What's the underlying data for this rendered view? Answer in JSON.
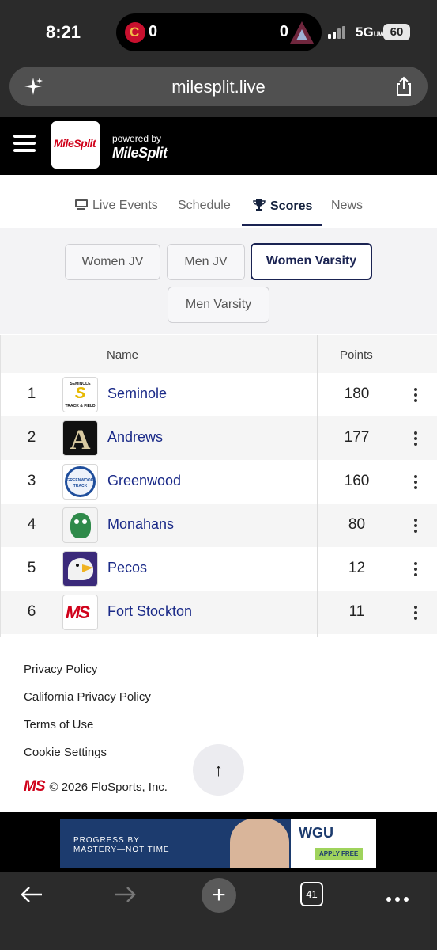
{
  "status_bar": {
    "time": "8:21",
    "score_left": "0",
    "score_right": "0",
    "network": "5G",
    "network_suffix": "UW",
    "battery": "60"
  },
  "browser": {
    "url": "milesplit.live",
    "tabs_count": "41"
  },
  "header": {
    "logo_text": "MileSplit",
    "powered_by": "powered by",
    "powered_logo": "MileSplit"
  },
  "nav_tabs": [
    {
      "label": "Live Events",
      "icon": "live-events-icon"
    },
    {
      "label": "Schedule"
    },
    {
      "label": "Scores",
      "icon": "trophy-icon",
      "active": true
    },
    {
      "label": "News"
    }
  ],
  "filters": [
    {
      "label": "Women JV"
    },
    {
      "label": "Men JV"
    },
    {
      "label": "Women Varsity",
      "active": true
    },
    {
      "label": "Men Varsity"
    }
  ],
  "table": {
    "col_name": "Name",
    "col_points": "Points",
    "rows": [
      {
        "rank": "1",
        "name": "Seminole",
        "points": "180",
        "logo_lines": [
          "SEMINOLE",
          "S",
          "TRACK & FIELD"
        ]
      },
      {
        "rank": "2",
        "name": "Andrews",
        "points": "177",
        "logo_lines": [
          "A"
        ]
      },
      {
        "rank": "3",
        "name": "Greenwood",
        "points": "160",
        "logo_lines": [
          "GREENWOOD",
          "TRACK"
        ]
      },
      {
        "rank": "4",
        "name": "Monahans",
        "points": "80",
        "logo_lines": []
      },
      {
        "rank": "5",
        "name": "Pecos",
        "points": "12",
        "logo_lines": []
      },
      {
        "rank": "6",
        "name": "Fort Stockton",
        "points": "11",
        "logo_lines": [
          "MS"
        ]
      }
    ]
  },
  "footer": {
    "links": [
      "Privacy Policy",
      "California Privacy Policy",
      "Terms of Use",
      "Cookie Settings"
    ],
    "logo": "MS",
    "copyright": "© 2026 FloSports, Inc."
  },
  "ad": {
    "line1": "PROGRESS BY",
    "line2": "MASTERY—NOT TIME",
    "brand": "WGU",
    "cta": "APPLY FREE"
  },
  "colors": {
    "accent": "#1a2352",
    "link": "#1a2a88",
    "brand_red": "#d0021b"
  }
}
